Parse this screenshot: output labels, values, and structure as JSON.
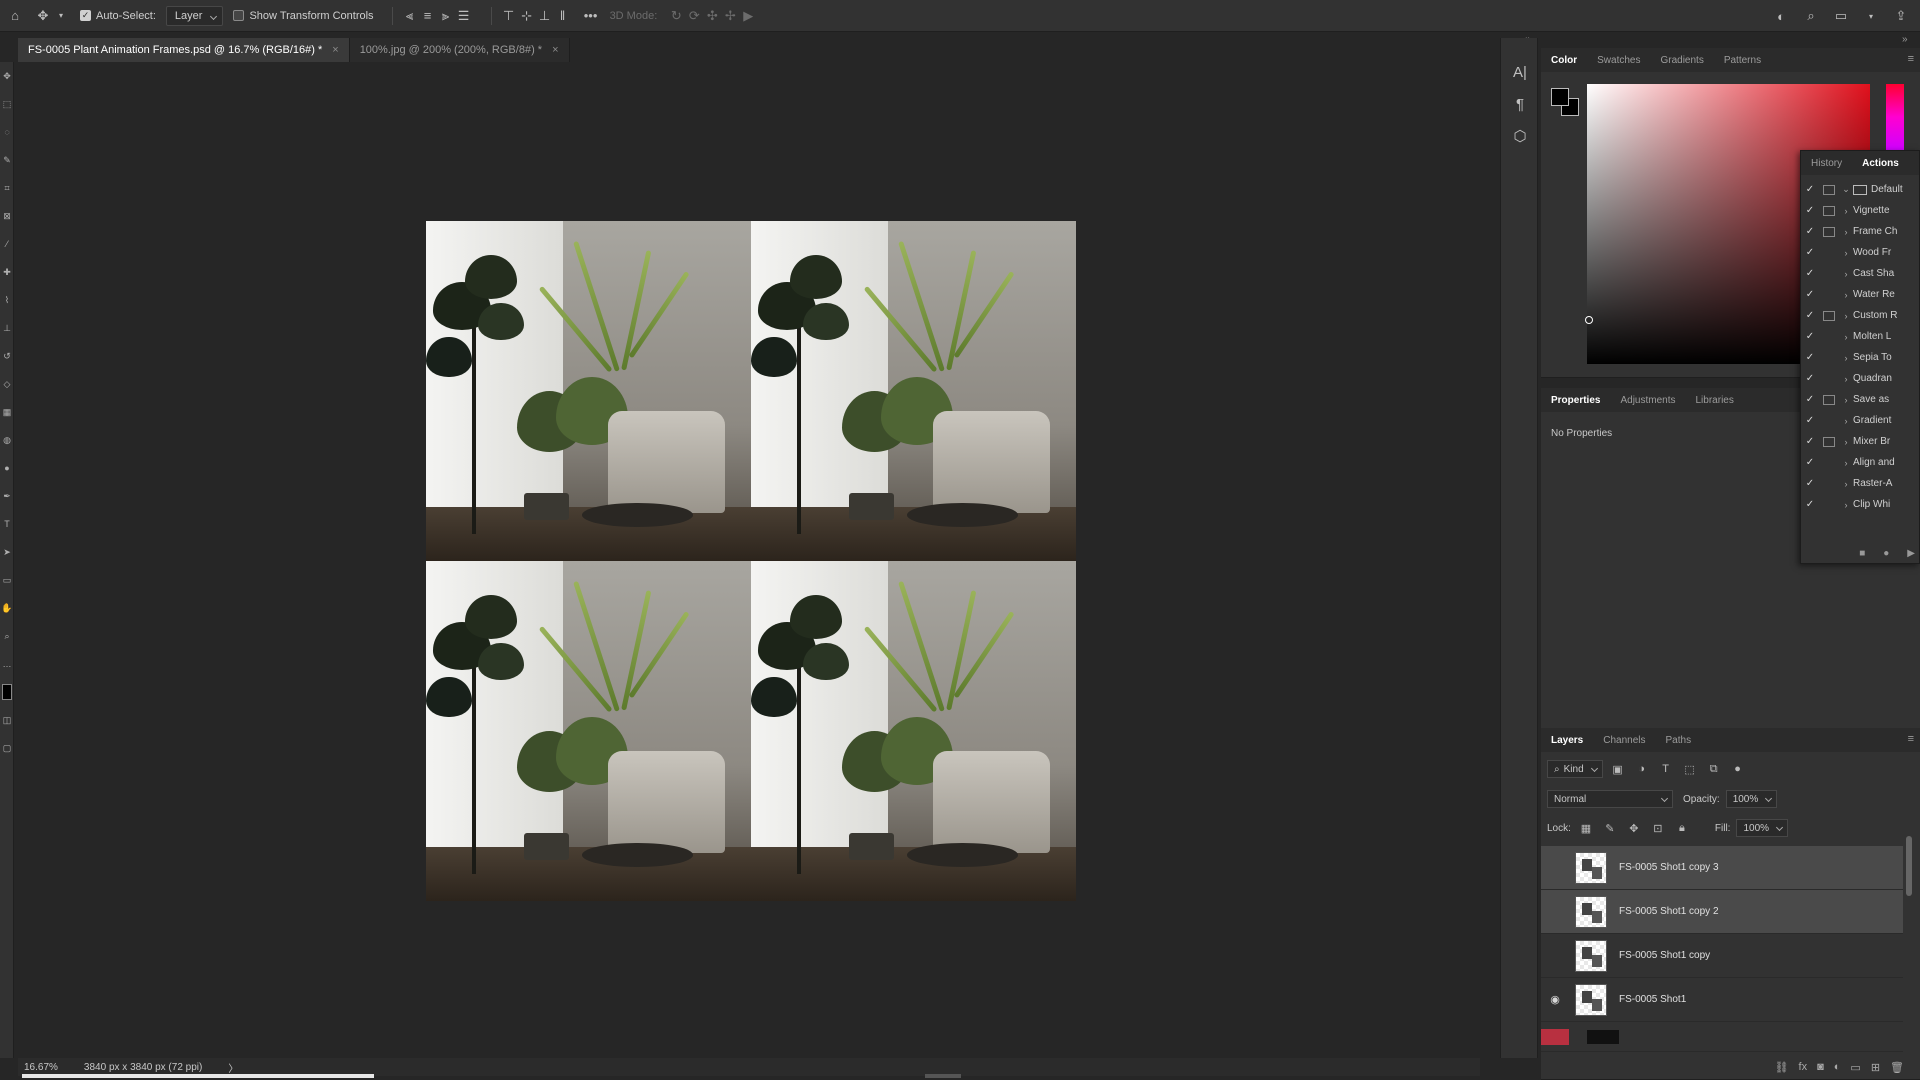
{
  "options_bar": {
    "auto_select_label": "Auto-Select:",
    "auto_select_target": "Layer",
    "show_transform_label": "Show Transform Controls",
    "three_d_mode_label": "3D Mode:",
    "more_label": "•••"
  },
  "document_tabs": [
    {
      "label": "FS-0005 Plant Animation Frames.psd @ 16.7% (RGB/16#) *",
      "close": "×"
    },
    {
      "label": "100%.jpg @ 200% (200%, RGB/8#) *",
      "close": "×"
    }
  ],
  "status_bar": {
    "zoom": "16.67%",
    "dimensions": "3840 px x 3840 px (72 ppi)",
    "arrow": "〉"
  },
  "progress": {
    "fraction": 0.22
  },
  "color_panel": {
    "tabs": [
      "Color",
      "Swatches",
      "Gradients",
      "Patterns"
    ],
    "active_tab": "Color",
    "foreground_color": "#000000",
    "background_color": "#000000"
  },
  "properties_panel": {
    "tabs": [
      "Properties",
      "Adjustments",
      "Libraries"
    ],
    "active_tab": "Properties",
    "message": "No Properties"
  },
  "actions_panel": {
    "tabs": [
      "History",
      "Actions"
    ],
    "active_tab": "Actions",
    "items": [
      {
        "label": "Default",
        "check": "✓",
        "dialog": true,
        "folder": true,
        "expanded": true
      },
      {
        "label": "Vignette",
        "check": "✓",
        "dialog": true
      },
      {
        "label": "Frame Ch",
        "check": "✓",
        "dialog": true
      },
      {
        "label": "Wood Fr",
        "check": "✓",
        "dialog": false
      },
      {
        "label": "Cast Sha",
        "check": "✓",
        "dialog": false
      },
      {
        "label": "Water Re",
        "check": "✓",
        "dialog": false
      },
      {
        "label": "Custom R",
        "check": "✓",
        "dialog": true
      },
      {
        "label": "Molten L",
        "check": "✓",
        "dialog": false
      },
      {
        "label": "Sepia To",
        "check": "✓",
        "dialog": false
      },
      {
        "label": "Quadran",
        "check": "✓",
        "dialog": false
      },
      {
        "label": "Save as ",
        "check": "✓",
        "dialog": true
      },
      {
        "label": "Gradient",
        "check": "✓",
        "dialog": false
      },
      {
        "label": "Mixer Br",
        "check": "✓",
        "dialog": true
      },
      {
        "label": "Align and",
        "check": "✓",
        "dialog": false
      },
      {
        "label": "Raster-A",
        "check": "✓",
        "dialog": false
      },
      {
        "label": "Clip Whi",
        "check": "✓",
        "dialog": false
      }
    ]
  },
  "layers_panel": {
    "tabs": [
      "Layers",
      "Channels",
      "Paths"
    ],
    "active_tab": "Layers",
    "filter_kind": "Kind",
    "blend_mode": "Normal",
    "opacity_label": "Opacity:",
    "opacity_value": "100%",
    "lock_label": "Lock:",
    "fill_label": "Fill:",
    "fill_value": "100%",
    "layers": [
      {
        "name": "FS-0005 Shot1 copy 3",
        "visible": false,
        "selected": true
      },
      {
        "name": "FS-0005 Shot1 copy 2",
        "visible": false,
        "selected": true
      },
      {
        "name": "FS-0005 Shot1 copy",
        "visible": false,
        "selected": false
      },
      {
        "name": "FS-0005 Shot1",
        "visible": true,
        "selected": false
      }
    ]
  },
  "icons": {
    "eye": "◉",
    "check": "✓"
  }
}
